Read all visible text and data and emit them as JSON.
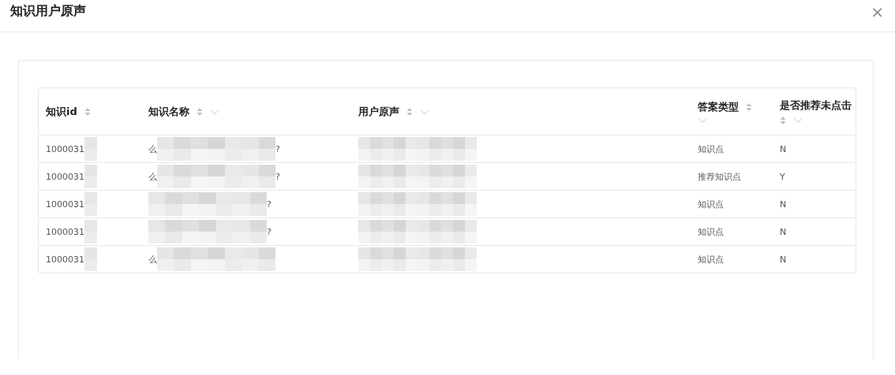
{
  "dialog": {
    "title": "知识用户原声",
    "close": "×"
  },
  "table": {
    "columns": [
      {
        "label": "知识id",
        "sortable": true,
        "filterable": false
      },
      {
        "label": "知识名称",
        "sortable": true,
        "filterable": true
      },
      {
        "label": "用户原声",
        "sortable": true,
        "filterable": true
      },
      {
        "label": "答案类型",
        "sortable": true,
        "filterable": true
      },
      {
        "label": "是否推荐未点击",
        "sortable": true,
        "filterable": true
      }
    ],
    "rows": [
      {
        "cells": [
          {
            "text": "1000031",
            "blurred": true
          },
          {
            "text": "么",
            "tail": "?",
            "blurred": true
          },
          {
            "text": "",
            "blurred": true
          },
          {
            "text": "知识点",
            "blurred": false
          },
          {
            "text": "N",
            "blurred": false
          }
        ]
      },
      {
        "cells": [
          {
            "text": "1000031",
            "blurred": true
          },
          {
            "text": "么",
            "tail": "?",
            "blurred": true
          },
          {
            "text": "",
            "blurred": true
          },
          {
            "text": "推荐知识点",
            "blurred": false
          },
          {
            "text": "Y",
            "blurred": false
          }
        ]
      },
      {
        "cells": [
          {
            "text": "1000031",
            "blurred": true
          },
          {
            "text": "",
            "tail": "?",
            "blurred": true
          },
          {
            "text": "",
            "blurred": true
          },
          {
            "text": "知识点",
            "blurred": false
          },
          {
            "text": "N",
            "blurred": false
          }
        ]
      },
      {
        "cells": [
          {
            "text": "1000031",
            "blurred": true
          },
          {
            "text": "",
            "tail": "?",
            "blurred": true
          },
          {
            "text": "",
            "blurred": true
          },
          {
            "text": "知识点",
            "blurred": false
          },
          {
            "text": "N",
            "blurred": false
          }
        ]
      },
      {
        "cells": [
          {
            "text": "1000031",
            "blurred": true
          },
          {
            "text": "么",
            "blurred": true
          },
          {
            "text": "",
            "blurred": true
          },
          {
            "text": "知识点",
            "blurred": false
          },
          {
            "text": "N",
            "blurred": false
          }
        ]
      }
    ]
  }
}
